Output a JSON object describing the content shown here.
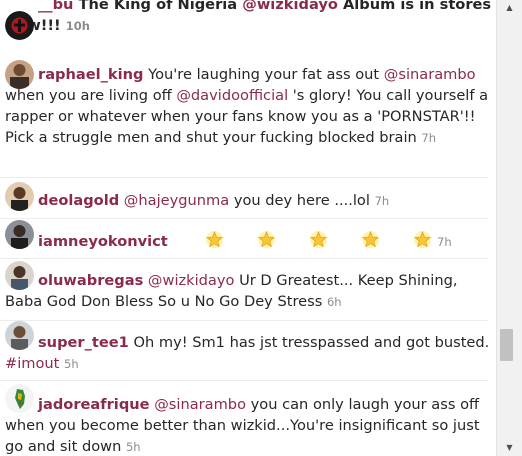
{
  "feed": {
    "comments": [
      {
        "user": "__bu",
        "segments": [
          {
            "t": "plain",
            "v": " The King of Nigeria "
          },
          {
            "t": "mention",
            "v": "@wizkidayo"
          },
          {
            "t": "plain",
            "v": " Album is in stores Now!!!"
          }
        ],
        "time": "10h",
        "bold_text": true
      },
      {
        "user": "raphael_king",
        "segments": [
          {
            "t": "plain",
            "v": " You're laughing your fat ass out "
          },
          {
            "t": "mention",
            "v": "@sinarambo"
          },
          {
            "t": "plain",
            "v": " when you are living off "
          },
          {
            "t": "mention",
            "v": "@davidoofficial"
          },
          {
            "t": "plain",
            "v": " 's glory! You call yourself a rapper or whatever when your fans know you as a 'PORNSTAR'!! Pick a struggle men and shut your fucking blocked brain"
          }
        ],
        "time": "7h"
      },
      {
        "user": "deolagold",
        "segments": [
          {
            "t": "plain",
            "v": " "
          },
          {
            "t": "mention",
            "v": "@hajeygunma"
          },
          {
            "t": "plain",
            "v": " you dey here ....lol"
          }
        ],
        "time": "7h"
      },
      {
        "user": "iamneyokonvict",
        "segments": [],
        "emoji_count": 5,
        "emoji_name": "glowing-star-icon",
        "time": "7h"
      },
      {
        "user": "oluwabregas",
        "segments": [
          {
            "t": "plain",
            "v": " "
          },
          {
            "t": "mention",
            "v": "@wizkidayo"
          },
          {
            "t": "plain",
            "v": " Ur D Greatest... Keep Shining, Baba God Don Bless So u No Go Dey Stress"
          }
        ],
        "time": "6h"
      },
      {
        "user": "super_tee1",
        "segments": [
          {
            "t": "plain",
            "v": " Oh my! Sm1 has jst tresspassed and got busted. "
          },
          {
            "t": "tag",
            "v": "#imout"
          }
        ],
        "time": "5h"
      },
      {
        "user": "jadoreafrique",
        "segments": [
          {
            "t": "plain",
            "v": " "
          },
          {
            "t": "mention",
            "v": "@sinarambo"
          },
          {
            "t": "plain",
            "v": " you can only laugh your ass off when you become better than wizkid...You're insignificant so just go and sit down"
          }
        ],
        "time": "5h"
      }
    ]
  },
  "colors": {
    "username": "#8b2b4b",
    "text": "#262626",
    "time": "#8c8c8c"
  },
  "scrollbar": {
    "up_arrow": "▲",
    "down_arrow": "▼"
  }
}
